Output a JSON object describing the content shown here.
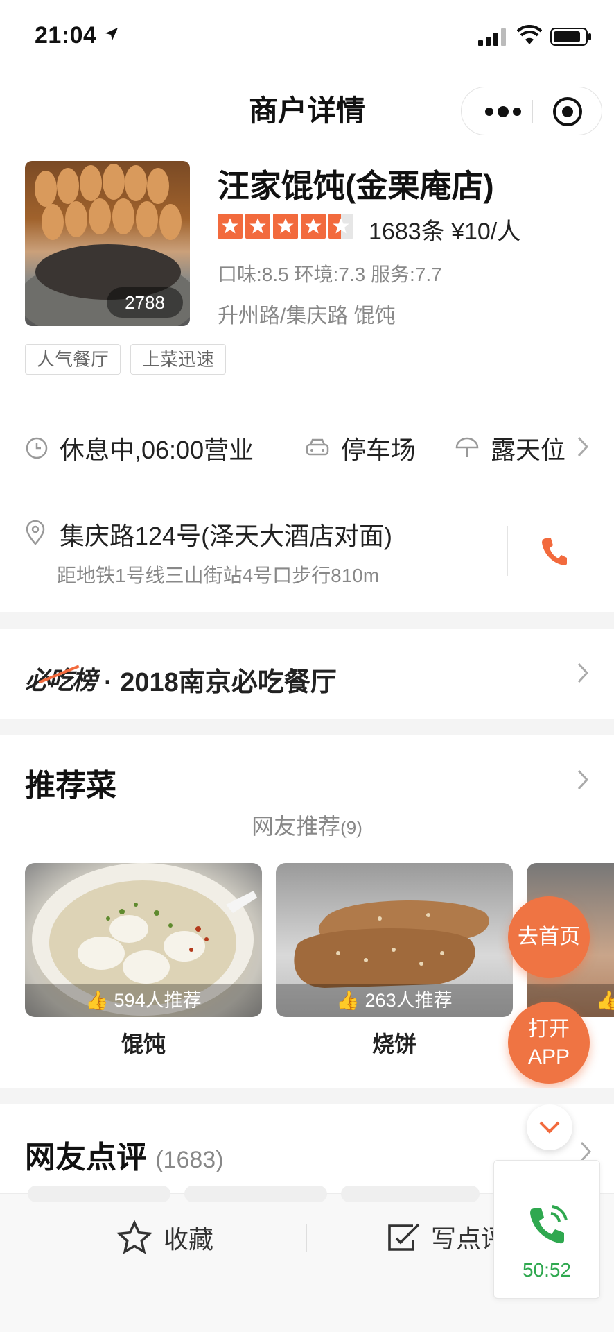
{
  "status": {
    "time": "21:04"
  },
  "nav": {
    "title": "商户详情"
  },
  "shop": {
    "name": "汪家馄饨(金栗庵店)",
    "photo_count": "2788",
    "rating_stars": 4.5,
    "reviews_price": "1683条  ¥10/人",
    "scores": "口味:8.5 环境:7.3 服务:7.7",
    "region": "升州路/集庆路   馄饨",
    "tags": [
      "人气餐厅",
      "上菜迅速"
    ]
  },
  "facilities": {
    "hours": "休息中,06:00营业",
    "parking": "停车场",
    "outdoor": "露天位"
  },
  "address": {
    "street": "集庆路124号(泽天大酒店对面)",
    "metro": "距地铁1号线三山街站4号口步行810m"
  },
  "ranking": {
    "logo": "必吃榜",
    "text": "· 2018南京必吃餐厅"
  },
  "recommended": {
    "title": "推荐菜",
    "subtitle": "网友推荐",
    "subtitle_count": "(9)",
    "dishes": [
      {
        "name": "馄饨",
        "likes": "594人推荐"
      },
      {
        "name": "烧饼",
        "likes": "263人推荐"
      }
    ]
  },
  "float": {
    "home": "去首页",
    "open_app": "打开APP"
  },
  "reviews": {
    "title": "网友点评",
    "count": "(1683)"
  },
  "bottom": {
    "favorite": "收藏",
    "write": "写点评"
  },
  "call": {
    "timer": "50:52"
  },
  "colors": {
    "accent": "#f26a3d",
    "call_green": "#2fa84f"
  }
}
